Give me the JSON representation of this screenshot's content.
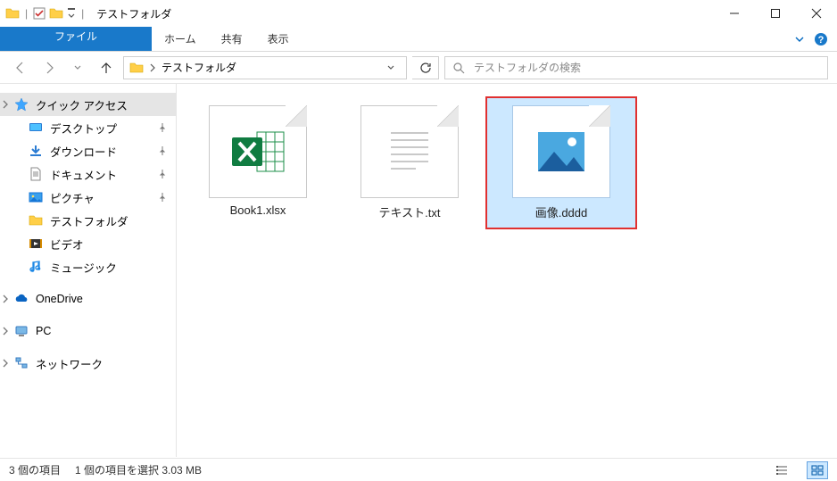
{
  "window": {
    "title": "テストフォルダ"
  },
  "ribbon": {
    "file": "ファイル",
    "home": "ホーム",
    "share": "共有",
    "view": "表示"
  },
  "address": {
    "crumb0": "テストフォルダ"
  },
  "search": {
    "placeholder": "テストフォルダの検索"
  },
  "nav": {
    "quick_access": "クイック アクセス",
    "desktop": "デスクトップ",
    "downloads": "ダウンロード",
    "documents": "ドキュメント",
    "pictures": "ピクチャ",
    "test_folder": "テストフォルダ",
    "videos": "ビデオ",
    "music": "ミュージック",
    "onedrive": "OneDrive",
    "pc": "PC",
    "network": "ネットワーク"
  },
  "files": {
    "f0": "Book1.xlsx",
    "f1": "テキスト.txt",
    "f2": "画像.dddd"
  },
  "status": {
    "count": "3 個の項目",
    "selected": "1 個の項目を選択 3.03 MB"
  }
}
